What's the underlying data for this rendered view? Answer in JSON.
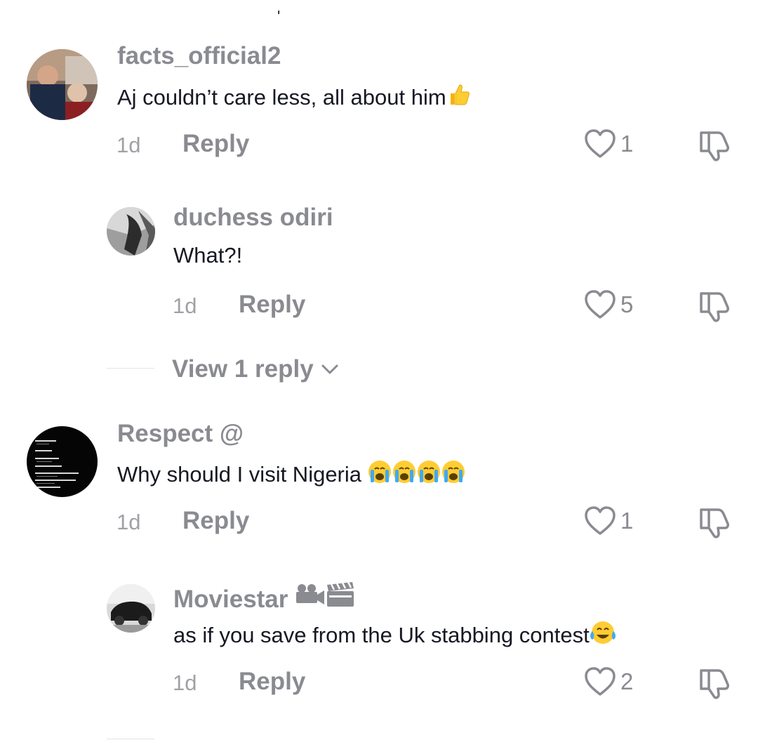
{
  "comments": [
    {
      "username": "facts_official2",
      "text": "Aj couldn’t care less, all about him",
      "emoji_suffix": [
        "thumbs-up-emoji"
      ],
      "time": "1d",
      "reply_label": "Reply",
      "likes": "1",
      "avatar": "politician-photo"
    },
    {
      "username": "duchess odiri",
      "text": "What?!",
      "time": "1d",
      "reply_label": "Reply",
      "likes": "5",
      "avatar": "grayscale-photo",
      "view_replies": "View 1 reply"
    },
    {
      "username": "Respect @",
      "text": "Why should I visit Nigeria ",
      "emoji_suffix": [
        "loudly-crying-emoji",
        "loudly-crying-emoji",
        "loudly-crying-emoji",
        "loudly-crying-emoji"
      ],
      "time": "1d",
      "reply_label": "Reply",
      "likes": "1",
      "avatar": "dark-text-list"
    },
    {
      "username": "Moviestar",
      "username_emoji": [
        "camera-emoji",
        "clapper-board-emoji"
      ],
      "text": "as if you save from the Uk stabbing contest",
      "emoji_suffix": [
        "tears-of-joy-emoji"
      ],
      "time": "1d",
      "reply_label": "Reply",
      "likes": "2",
      "avatar": "car-photo"
    }
  ],
  "colors": {
    "secondary_text": "#8a8b91",
    "primary_text": "#161823",
    "background": "#ffffff"
  }
}
